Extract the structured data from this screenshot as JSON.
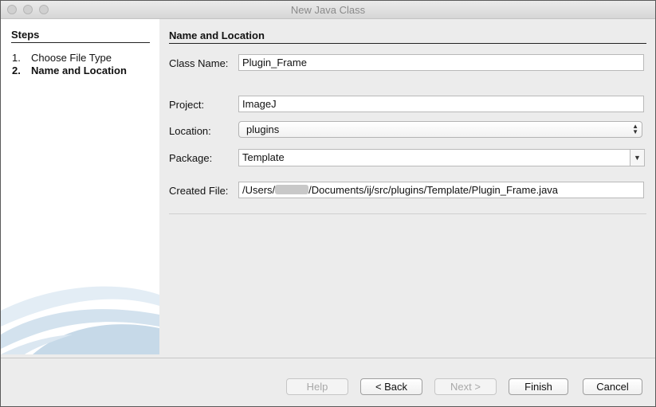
{
  "window": {
    "title": "New Java Class"
  },
  "steps": {
    "heading": "Steps",
    "items": [
      {
        "num": "1.",
        "label": "Choose File Type"
      },
      {
        "num": "2.",
        "label": "Name and Location"
      }
    ],
    "current_index": 1
  },
  "panel": {
    "heading": "Name and Location",
    "class_name": {
      "label": "Class Name:",
      "value": "Plugin_Frame"
    },
    "project": {
      "label": "Project:",
      "value": "ImageJ"
    },
    "location": {
      "label": "Location:",
      "value": "plugins"
    },
    "package": {
      "label": "Package:",
      "value": "Template"
    },
    "created_file": {
      "label": "Created File:",
      "prefix": "/Users/",
      "suffix": "/Documents/ij/src/plugins/Template/Plugin_Frame.java"
    }
  },
  "buttons": {
    "help": "Help",
    "back": "< Back",
    "next": "Next >",
    "finish": "Finish",
    "cancel": "Cancel"
  }
}
